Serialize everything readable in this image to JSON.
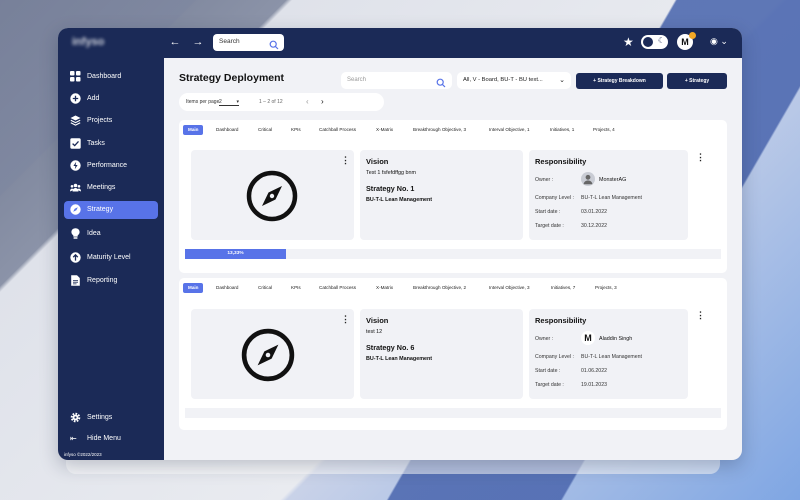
{
  "topbar": {
    "logo": "infyso",
    "search_placeholder": "Search",
    "avatar_letter": "M"
  },
  "sidebar": {
    "items": [
      {
        "label": "Dashboard",
        "icon": "grid-icon"
      },
      {
        "label": "Add",
        "icon": "plus-circle-icon"
      },
      {
        "label": "Projects",
        "icon": "layers-icon"
      },
      {
        "label": "Tasks",
        "icon": "checkbox-icon"
      },
      {
        "label": "Performance",
        "icon": "lightning-icon"
      },
      {
        "label": "Meetings",
        "icon": "people-icon"
      },
      {
        "label": "Strategy",
        "icon": "compass-icon"
      },
      {
        "label": "Idea",
        "icon": "bulb-icon"
      },
      {
        "label": "Maturity Level",
        "icon": "arrow-up-circle-icon"
      },
      {
        "label": "Reporting",
        "icon": "report-icon"
      }
    ],
    "settings_label": "Settings",
    "hide_menu_label": "Hide Menu",
    "version": "infyso ©2022/2023"
  },
  "main": {
    "title": "Strategy Deployment",
    "search_placeholder": "Search",
    "filter_value": "All, V - Board, BU-T - BU text...",
    "btn_breakdown": "Strategy Breakdown",
    "btn_strategy": "Strategy",
    "pager": {
      "items_per_page_label": "Items per page",
      "items_per_page_value": "2",
      "range": "1 – 2 of 12"
    }
  },
  "cards": [
    {
      "tabs": [
        "Main",
        "Dashboard",
        "Critical",
        "KPIs",
        "Catchball Process",
        "X-Matrix",
        "Breakthrough Objective, 3",
        "Interval Objective, 1",
        "Initiatives, 1",
        "Projects, 4"
      ],
      "vision_title": "Vision",
      "vision_text": "Test 1 fsfefdffgg bnm",
      "strategy_no": "Strategy No. 1",
      "unit": "BU-T-L Lean Management",
      "responsibility_title": "Responsibility",
      "owner_label": "Owner :",
      "owner_name": "MonsterAG",
      "company_label": "Company Level :",
      "company_value": "BU-T-L Lean Management",
      "start_label": "Start date :",
      "start_value": "03.01.2022",
      "target_label": "Target date :",
      "target_value": "30.12.2022",
      "progress_label": "13,33%",
      "progress": 0.1333
    },
    {
      "tabs": [
        "Main",
        "Dashboard",
        "Critical",
        "KPIs",
        "Catchball Process",
        "X-Matrix",
        "Breakthrough Objective, 2",
        "Interval Objective, 3",
        "Initiatives, 7",
        "Projects, 3"
      ],
      "vision_title": "Vision",
      "vision_text": "test 12",
      "strategy_no": "Strategy No. 6",
      "unit": "BU-T-L Lean Management",
      "responsibility_title": "Responsibility",
      "owner_label": "Owner :",
      "owner_name": "Aladdin Singh",
      "owner_letter": "M",
      "company_label": "Company Level :",
      "company_value": "BU-T-L Lean Management",
      "start_label": "Start date :",
      "start_value": "01.06.2022",
      "target_label": "Target date :",
      "target_value": "19.01.2023",
      "progress_label": "",
      "progress": 0
    }
  ],
  "colors": {
    "navy": "#1b2a57",
    "accent": "#5873e8",
    "panel": "#f1f2f6"
  }
}
